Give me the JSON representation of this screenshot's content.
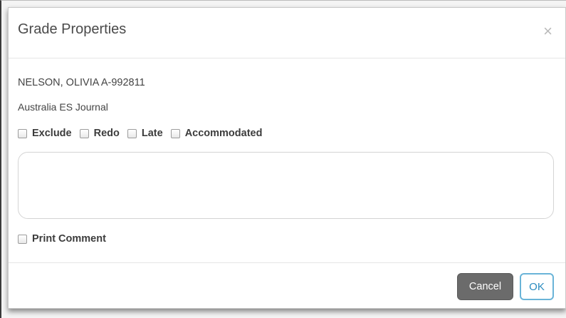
{
  "dialog": {
    "title": "Grade Properties",
    "close_glyph": "×"
  },
  "student": {
    "name": "NELSON, OLIVIA A-992811",
    "course": "Australia ES Journal"
  },
  "options": [
    {
      "label": "Exclude",
      "checked": false
    },
    {
      "label": "Redo",
      "checked": false
    },
    {
      "label": "Late",
      "checked": false
    },
    {
      "label": "Accommodated",
      "checked": false
    }
  ],
  "comment": {
    "value": ""
  },
  "print_comment": {
    "label": "Print Comment",
    "checked": false
  },
  "footer": {
    "cancel_label": "Cancel",
    "ok_label": "OK"
  },
  "colors": {
    "cancel_bg": "#6b6b6b",
    "ok_border": "#6ab4d8",
    "ok_text": "#2a8bbf"
  }
}
